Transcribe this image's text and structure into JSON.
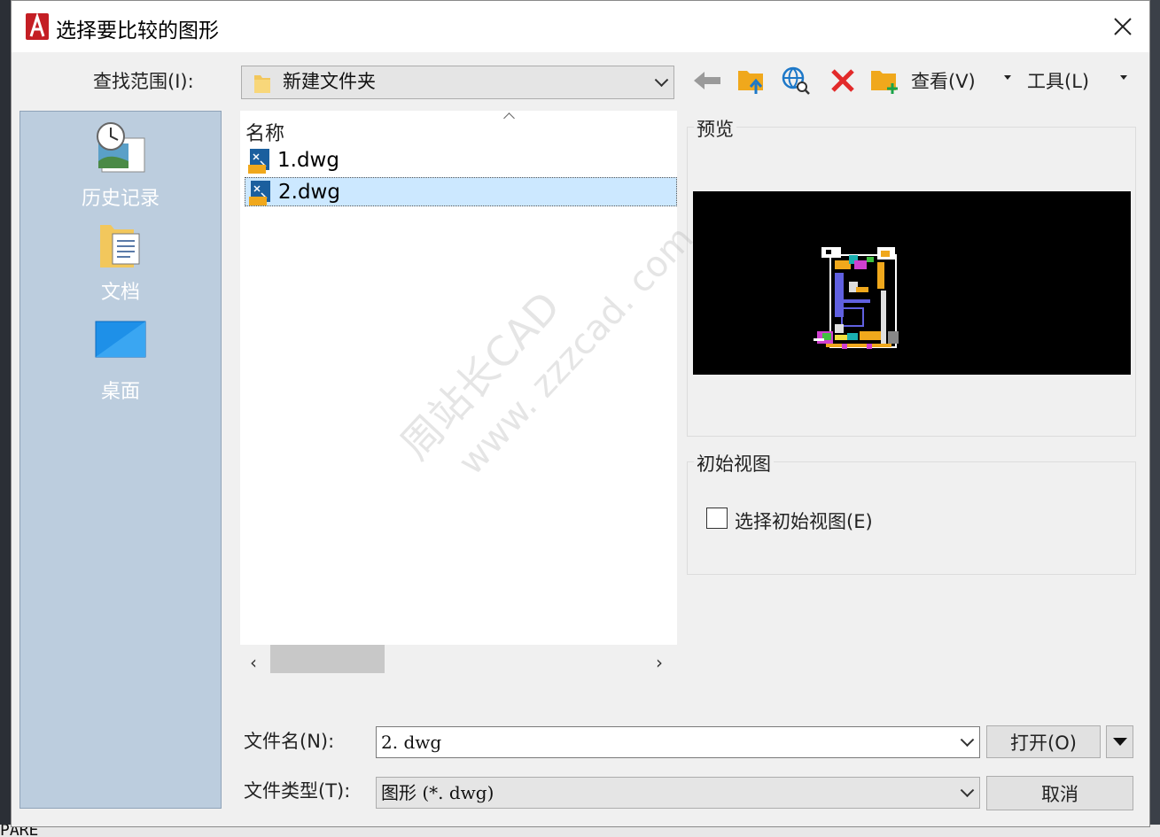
{
  "dialog": {
    "title": "选择要比较的图形",
    "look_in_label": "查找范围(I):",
    "look_in_value": "新建文件夹",
    "views_label": "查看(V)",
    "tools_label": "工具(L)"
  },
  "places": [
    {
      "label": "历史记录",
      "icon": "history-icon"
    },
    {
      "label": "文档",
      "icon": "documents-icon"
    },
    {
      "label": "桌面",
      "icon": "desktop-icon"
    }
  ],
  "file_list": {
    "column_header": "名称",
    "files": [
      {
        "name": "1.dwg",
        "selected": false
      },
      {
        "name": "2.dwg",
        "selected": true
      }
    ]
  },
  "preview": {
    "title": "预览"
  },
  "initial_view": {
    "title": "初始视图",
    "checkbox_label": "选择初始视图(E)",
    "checked": false
  },
  "filename": {
    "label": "文件名(N):",
    "value": "2. dwg"
  },
  "filetype": {
    "label": "文件类型(T):",
    "value": "图形 (*. dwg)"
  },
  "buttons": {
    "open": "打开(O)",
    "cancel": "取消"
  },
  "watermark": {
    "line1": "周站长CAD",
    "line2": "www. zzzcad. com"
  },
  "background": {
    "bottom_text": "PARE"
  },
  "colors": {
    "accent_red": "#d8262b",
    "selection": "#cce8ff",
    "places_bg": "#bccdde"
  }
}
